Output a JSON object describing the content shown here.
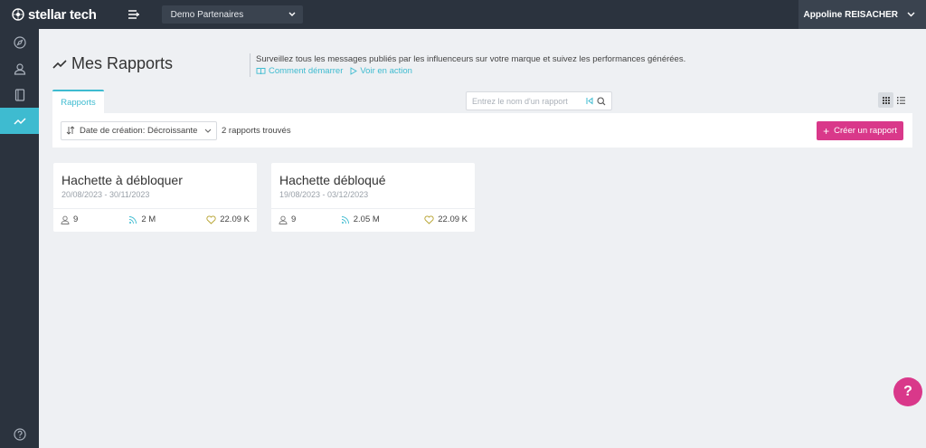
{
  "brand": {
    "name": "stellar tech"
  },
  "workspace": {
    "selected": "Demo Partenaires"
  },
  "user": {
    "name": "Appoline REISACHER"
  },
  "sidebar": {
    "items": [
      {
        "icon": "compass-icon"
      },
      {
        "icon": "user-icon"
      },
      {
        "icon": "book-icon"
      },
      {
        "icon": "trend-icon",
        "active": true
      }
    ],
    "help_icon": "help-circle-icon"
  },
  "page": {
    "title": "Mes Rapports",
    "description": "Surveillez tous les messages publiés par les influenceurs sur votre marque et suivez les performances générées.",
    "links": [
      {
        "label": "Comment démarrer",
        "icon": "book-open-icon"
      },
      {
        "label": "Voir en action",
        "icon": "play-icon"
      }
    ]
  },
  "tabs": [
    {
      "label": "Rapports",
      "active": true
    }
  ],
  "search": {
    "placeholder": "Entrez le nom d'un rapport"
  },
  "toolbar": {
    "sort_label": "Date de création: Décroissante",
    "count_text": "2 rapports trouvés",
    "create_label": "Créer un rapport"
  },
  "reports": [
    {
      "title": "Hachette à débloquer",
      "dates": "20/08/2023 - 30/11/2023",
      "influencers": "9",
      "reach": "2 M",
      "engagement": "22.09 K"
    },
    {
      "title": "Hachette débloqué",
      "dates": "19/08/2023 - 03/12/2023",
      "influencers": "9",
      "reach": "2.05 M",
      "engagement": "22.09 K"
    }
  ],
  "help_bubble": {
    "label": "?"
  },
  "colors": {
    "accent": "#3ebbd0",
    "primary": "#d9388a",
    "sidebar": "#2b333e"
  }
}
